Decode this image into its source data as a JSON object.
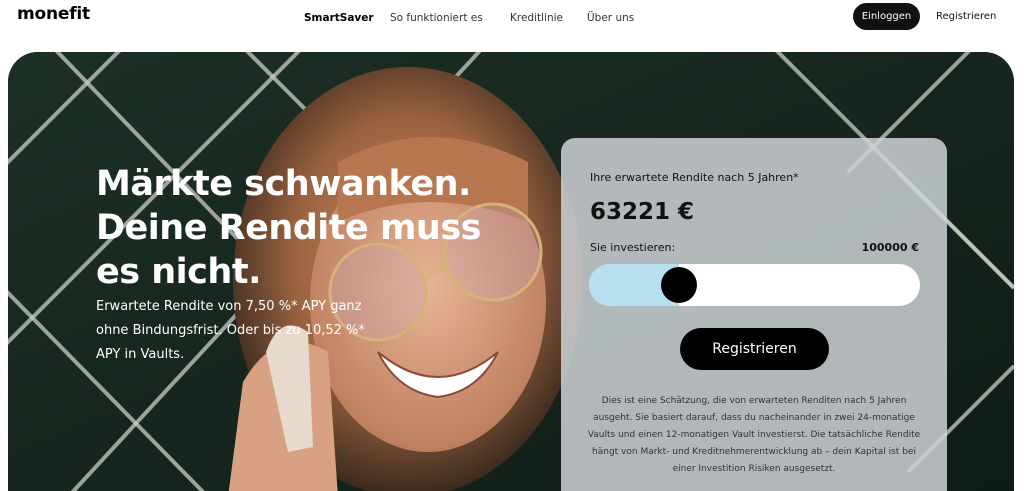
{
  "brand": {
    "logo": "monefit"
  },
  "nav": {
    "items": [
      "SmartSaver",
      "So funktioniert es",
      "Kreditlinie",
      "Über uns"
    ],
    "login_label": "Einloggen",
    "register_label": "Registrieren"
  },
  "hero": {
    "headline": [
      "Märkte schwanken.",
      "Deine Rendite muss",
      "es nicht."
    ],
    "subtext": "Erwartete Rendite von 7,50 %* APY ganz ohne Bindungsfrist. Oder bis zu 10,52 %* APY in Vaults."
  },
  "calculator": {
    "label": "Ihre erwartete Rendite nach 5 Jahren*",
    "amount": "63221 €",
    "invest_label": "Sie investieren:",
    "invest_value": "100000 €",
    "slider_fraction": 0.24,
    "button_label": "Registrieren",
    "disclaimer": "Dies ist eine Schätzung, die von erwarteten Renditen nach 5 Jahren ausgeht. Sie basiert darauf, dass du nacheinander in zwei 24-monatige Vaults und einen 12-monatigen Vault investierst. Die tatsächliche Rendite hängt von Markt- und Kreditnehmerentwicklung ab – dein Kapital ist bei einer Investition Risiken ausgesetzt."
  },
  "colors": {
    "accent_fill": "#b6dff0",
    "button": "#000000",
    "hero_bg": "#14241c"
  }
}
